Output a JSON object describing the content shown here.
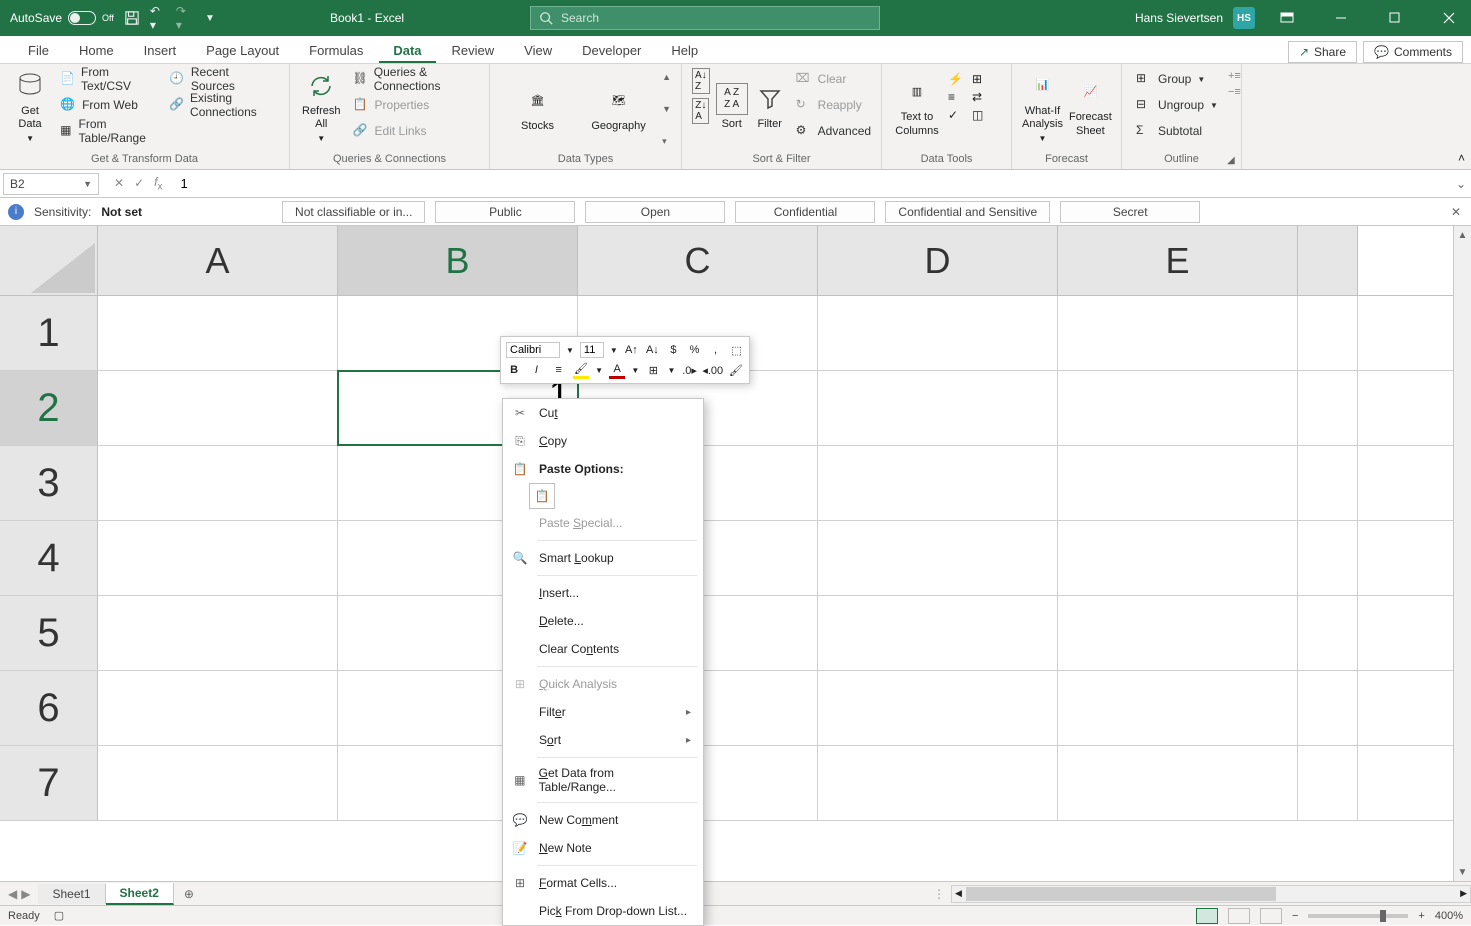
{
  "titlebar": {
    "autosave": "AutoSave",
    "autosave_state": "Off",
    "title": "Book1 - Excel",
    "search_placeholder": "Search",
    "user_name": "Hans Sievertsen",
    "user_initials": "HS"
  },
  "tabs": [
    "File",
    "Home",
    "Insert",
    "Page Layout",
    "Formulas",
    "Data",
    "Review",
    "View",
    "Developer",
    "Help"
  ],
  "active_tab": "Data",
  "share": "Share",
  "comments": "Comments",
  "ribbon": {
    "g1": {
      "get_data": "Get\nData",
      "items": [
        "From Text/CSV",
        "From Web",
        "From Table/Range",
        "Recent Sources",
        "Existing Connections"
      ],
      "label": "Get & Transform Data"
    },
    "g2": {
      "refresh": "Refresh\nAll",
      "items": [
        "Queries & Connections",
        "Properties",
        "Edit Links"
      ],
      "label": "Queries & Connections"
    },
    "g3": {
      "stocks": "Stocks",
      "geo": "Geography",
      "label": "Data Types"
    },
    "g4": {
      "sort": "Sort",
      "filter": "Filter",
      "clear": "Clear",
      "reapply": "Reapply",
      "advanced": "Advanced",
      "label": "Sort & Filter"
    },
    "g5": {
      "t2c": "Text to\nColumns",
      "label": "Data Tools"
    },
    "g6": {
      "whatif": "What-If\nAnalysis",
      "fsheet": "Forecast\nSheet",
      "label": "Forecast"
    },
    "g7": {
      "group": "Group",
      "ungroup": "Ungroup",
      "subtotal": "Subtotal",
      "label": "Outline"
    }
  },
  "namebox": "B2",
  "formula": "1",
  "sensitivity": {
    "title": "Sensitivity:",
    "state": "Not set",
    "chips": [
      "Not classifiable or in...",
      "Public",
      "Open",
      "Confidential",
      "Confidential and Sensitive",
      "Secret"
    ]
  },
  "cols": [
    "A",
    "B",
    "C",
    "D",
    "E",
    ""
  ],
  "rows": [
    "1",
    "2",
    "3",
    "4",
    "5",
    "6",
    "7"
  ],
  "active_cell_value": "1",
  "mini": {
    "font": "Calibri",
    "size": "11"
  },
  "ctx": {
    "cut": "Cut",
    "copy": "Copy",
    "paste_header": "Paste Options:",
    "paste_special": "Paste Special...",
    "smart": "Smart Lookup",
    "insert": "Insert...",
    "delete": "Delete...",
    "clear": "Clear Contents",
    "qa": "Quick Analysis",
    "filter": "Filter",
    "sort": "Sort",
    "getdata": "Get Data from Table/Range...",
    "newcomment": "New Comment",
    "newnote": "New Note",
    "format": "Format Cells...",
    "pick": "Pick From Drop-down List..."
  },
  "sheets": [
    "Sheet1",
    "Sheet2"
  ],
  "active_sheet": "Sheet2",
  "status": {
    "ready": "Ready",
    "zoom": "400%"
  }
}
